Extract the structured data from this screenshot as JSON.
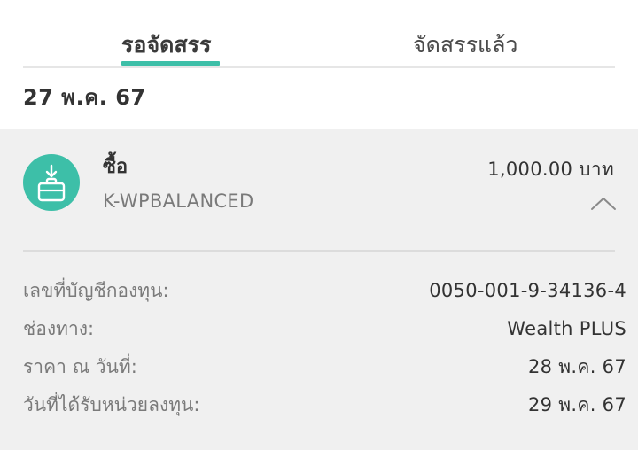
{
  "tabs": {
    "pending_label": "รอจัดสรร",
    "allocated_label": "จัดสรรแล้ว",
    "active_color": "#3dbfa8"
  },
  "date_header": "27 พ.ค. 67",
  "transaction": {
    "type_label": "ซื้อ",
    "fund_code": "K-WPBALANCED",
    "amount": "1,000.00 บาท",
    "icon": "buy-download-bag-icon",
    "accent_color": "#3dbfa8",
    "expanded": true,
    "details": [
      {
        "label": "เลขที่บัญชีกองทุน:",
        "value": "0050-001-9-34136-4"
      },
      {
        "label": "ช่องทาง:",
        "value": "Wealth PLUS"
      },
      {
        "label": "ราคา ณ วันที่:",
        "value": "28 พ.ค. 67"
      },
      {
        "label": "วันที่ได้รับหน่วยลงทุน:",
        "value": "29 พ.ค. 67"
      }
    ]
  }
}
